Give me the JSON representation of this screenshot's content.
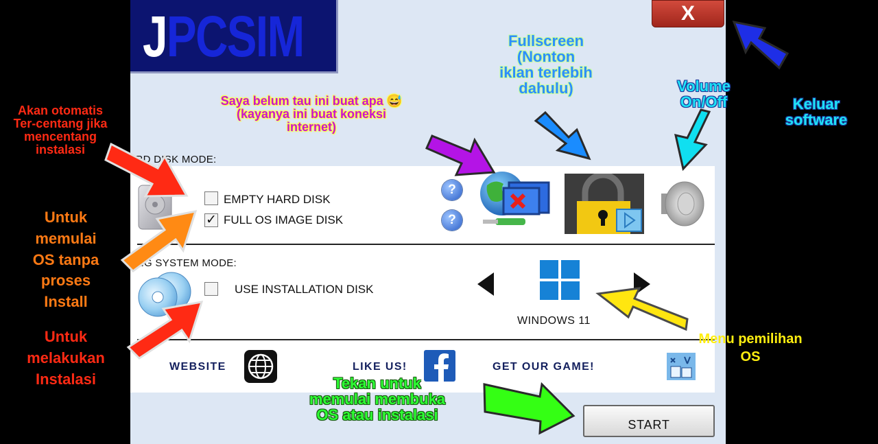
{
  "app": {
    "logo": {
      "first_letter": "J",
      "rest": "PCSIM"
    },
    "close_label": "X",
    "hard_disk": {
      "section_label": "HARD DISK MODE:",
      "options": [
        {
          "label": "EMPTY HARD DISK",
          "checked": false
        },
        {
          "label": "FULL OS IMAGE DISK",
          "checked": true
        }
      ],
      "check_mark": "✓"
    },
    "os_mode": {
      "section_label": "OPERATING SYSTEM MODE:",
      "option": {
        "label": "USE INSTALLATION DISK",
        "checked": false
      },
      "os_name": "WINDOWS 11"
    },
    "help_label": "?",
    "footer": {
      "website": "WEBSITE",
      "like_us": "LIKE US!",
      "get_game": "GET OUR GAME!"
    },
    "start_label": "START"
  },
  "annotations": {
    "auto_check": [
      "Akan otomatis",
      "Ter-centang jika",
      "mencentang",
      "instalasi"
    ],
    "start_no_install": [
      "Untuk",
      "memulai",
      "OS tanpa",
      "proses",
      "Install"
    ],
    "do_install": [
      "Untuk",
      "melakukan",
      "Instalasi"
    ],
    "unknown": [
      "Saya belum tau ini buat apa 😅",
      "(kayanya ini buat koneksi",
      "internet)"
    ],
    "fullscreen": [
      "Fullscreen",
      "(Nonton",
      "iklan terlebih",
      "dahulu)"
    ],
    "volume": [
      "Volume",
      "On/Off"
    ],
    "exit": [
      "Keluar",
      "software"
    ],
    "os_menu": [
      "Menu pemilihan",
      "OS"
    ],
    "press_start": [
      "Tekan untuk",
      "memulai membuka",
      "OS atau instalasi"
    ]
  },
  "colors": {
    "background": "#000000",
    "app_bg": "#dde7f4",
    "logo_bg": "#0c1470",
    "logo_blue": "#1626d8",
    "windows_blue": "#1682d6",
    "close_red": "#c03a2e",
    "arrow_red": "#ff2a14",
    "arrow_orange": "#ff8a14",
    "arrow_purple": "#b414e6",
    "arrow_blue": "#1a8cff",
    "arrow_cyan": "#10dff0",
    "arrow_darkblue": "#1e2ee6",
    "arrow_yellow": "#ffe610",
    "arrow_green": "#34ff14"
  },
  "icons": [
    "hard-disk-icon",
    "cd-disc-icon",
    "help-icon",
    "network-disconnected-icon",
    "fullscreen-lock-icon",
    "speaker-icon",
    "windows-logo-icon",
    "globe-icon",
    "facebook-icon",
    "game-icon",
    "close-icon"
  ]
}
